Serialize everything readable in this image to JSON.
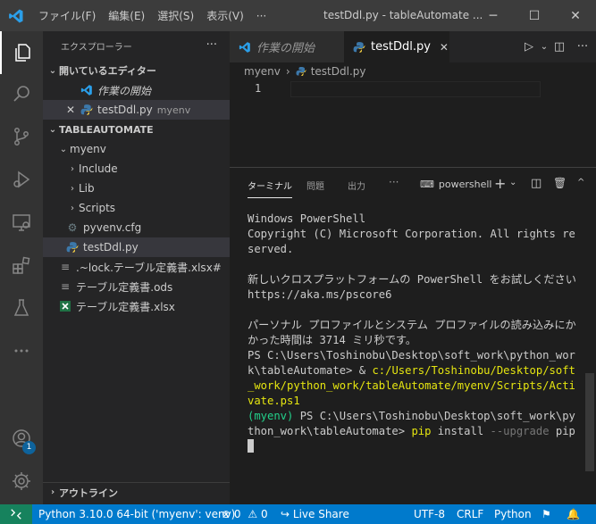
{
  "titlebar": {
    "menus": [
      "ファイル(F)",
      "編集(E)",
      "選択(S)",
      "表示(V)",
      "···"
    ],
    "title": "testDdl.py - tableAutomate ...",
    "minimize": "─",
    "maximize": "☐",
    "close": "✕"
  },
  "sidebar": {
    "header": "エクスプローラー",
    "more": "···",
    "open_editors_section": "開いているエディター",
    "open_editors": [
      {
        "label": "作業の開始",
        "desc": ""
      },
      {
        "label": "testDdl.py",
        "desc": "myenv"
      }
    ],
    "folder_section": "TABLEAUTOMATE",
    "tree": [
      {
        "label": "myenv"
      },
      {
        "label": "Include"
      },
      {
        "label": "Lib"
      },
      {
        "label": "Scripts"
      },
      {
        "label": "pyvenv.cfg"
      },
      {
        "label": "testDdl.py"
      },
      {
        "label": ".~lock.テーブル定義書.xlsx#"
      },
      {
        "label": "テーブル定義書.ods"
      },
      {
        "label": "テーブル定義書.xlsx"
      }
    ],
    "outline_section": "アウトライン"
  },
  "activity": {
    "accounts_badge": "1"
  },
  "editor": {
    "tabs": [
      {
        "label": "作業の開始"
      },
      {
        "label": "testDdl.py"
      }
    ],
    "tab_close": "✕",
    "breadcrumb": [
      "myenv",
      "testDdl.py"
    ],
    "line_numbers": [
      "1"
    ]
  },
  "panel": {
    "tabs": [
      "ターミナル",
      "問題",
      "出力",
      "···"
    ],
    "terminal_name": "powershell",
    "terminal": {
      "l1": "Windows PowerShell",
      "l2": "Copyright (C) Microsoft Corporation. All rights reserved.",
      "l3": "新しいクロスプラットフォームの PowerShell をお試しください https://aka.ms/pscore6",
      "l4": "パーソナル プロファイルとシステム プロファイルの読み込みにかかった時間は 3714 ミリ秒です。",
      "p1": "PS C:\\Users\\Toshinobu\\Desktop\\soft_work\\python_work\\tableAutomate> ",
      "amp": "& ",
      "act": "c:/Users/Toshinobu/Desktop/soft_work/python_work/tableAutomate/myenv/Scripts/Activate.ps1",
      "venv": "(myenv) ",
      "p2": "PS C:\\Users\\Toshinobu\\Desktop\\soft_work\\python_work\\tableAutomate> ",
      "cmd": "pip",
      "arg1": " install ",
      "arg2": "--upgrade",
      "arg3": " pip"
    }
  },
  "statusbar": {
    "interpreter": "Python 3.10.0 64-bit ('myenv': venv)",
    "errors": "0",
    "warnings": "0",
    "live_share": "Live Share",
    "encoding": "UTF-8",
    "eol": "CRLF",
    "language": "Python"
  },
  "colors": {
    "statusbar": "#007acc",
    "remote": "#16825d",
    "accent": "#0e639c",
    "prompt_yellow": "#e5e510",
    "venv_green": "#23d18b"
  }
}
